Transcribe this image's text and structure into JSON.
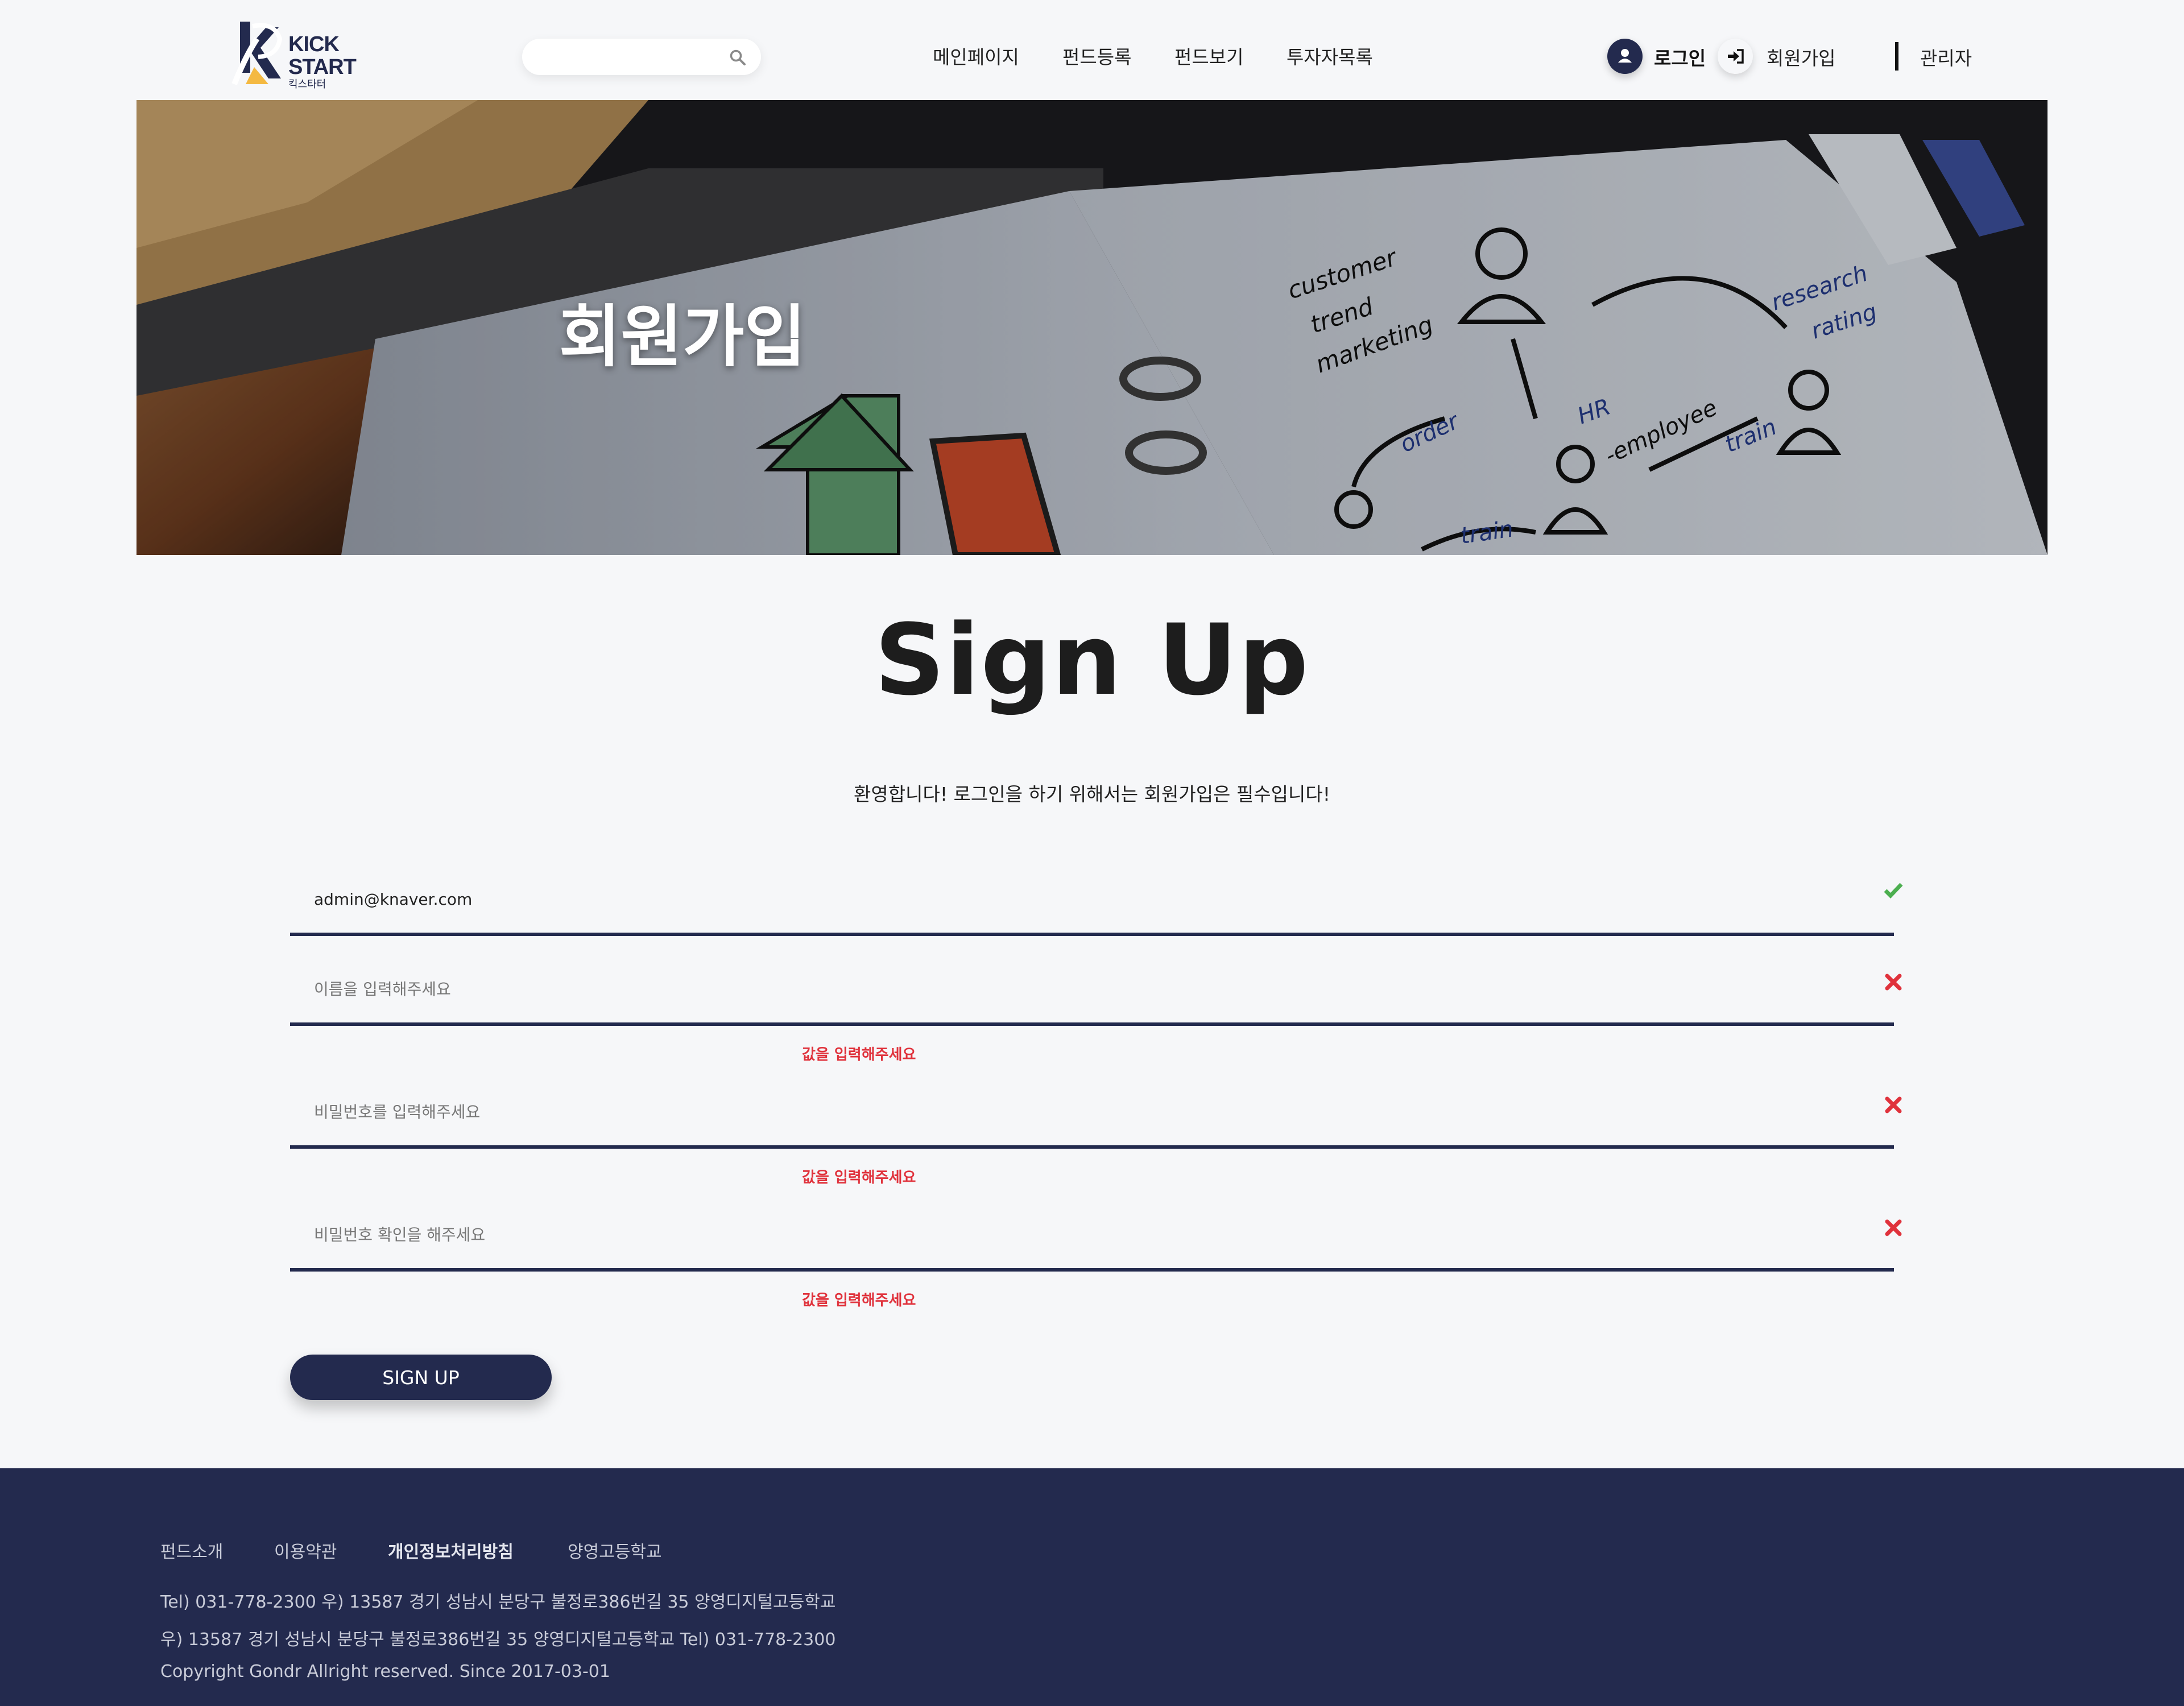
{
  "header": {
    "logo": {
      "line1": "KICK",
      "line2": "START",
      "sub": "킥스타터"
    },
    "search": {
      "placeholder": ""
    },
    "nav": [
      "메인페이지",
      "펀드등록",
      "펀드보기",
      "투자자목록"
    ],
    "auth": {
      "login": "로그인",
      "signup": "회원가입",
      "admin": "관리자"
    }
  },
  "hero": {
    "title": "회원가입",
    "notebook_words": [
      "customer",
      "trend",
      "marketing",
      "order",
      "HR",
      "-employee",
      "train",
      "train",
      "research",
      "rating"
    ]
  },
  "main": {
    "title": "Sign Up",
    "welcome": "환영합니다! 로그인을 하기 위해서는 회원가입은 필수입니다!",
    "fields": [
      {
        "value": "admin@knaver.com",
        "placeholder": "",
        "status": "valid",
        "error": ""
      },
      {
        "value": "",
        "placeholder": "이름을 입력해주세요",
        "status": "invalid",
        "error": "값을 입력해주세요"
      },
      {
        "value": "",
        "placeholder": "비밀번호를 입력해주세요",
        "status": "invalid",
        "error": "값을 입력해주세요"
      },
      {
        "value": "",
        "placeholder": "비밀번호 확인을 해주세요",
        "status": "invalid",
        "error": "값을 입력해주세요"
      }
    ],
    "submit": "SIGN UP"
  },
  "footer": {
    "links": [
      "펀드소개",
      "이용약관",
      "개인정보처리방침",
      "양영고등학교"
    ],
    "line1": "Tel) 031-778-2300     우) 13587 경기 성남시 분당구 불정로386번길 35 양영디지털고등학교",
    "line2": "우) 13587 경기 성남시 분당구 불정로386번길 35 양영디지털고등학교     Tel) 031-778-2300",
    "copyright": "Copyright Gondr Allright reserved. Since 2017-03-01"
  },
  "colors": {
    "navy": "#232a4e",
    "valid": "#4caf50",
    "error": "#e0323c",
    "background": "#f6f7f9"
  }
}
